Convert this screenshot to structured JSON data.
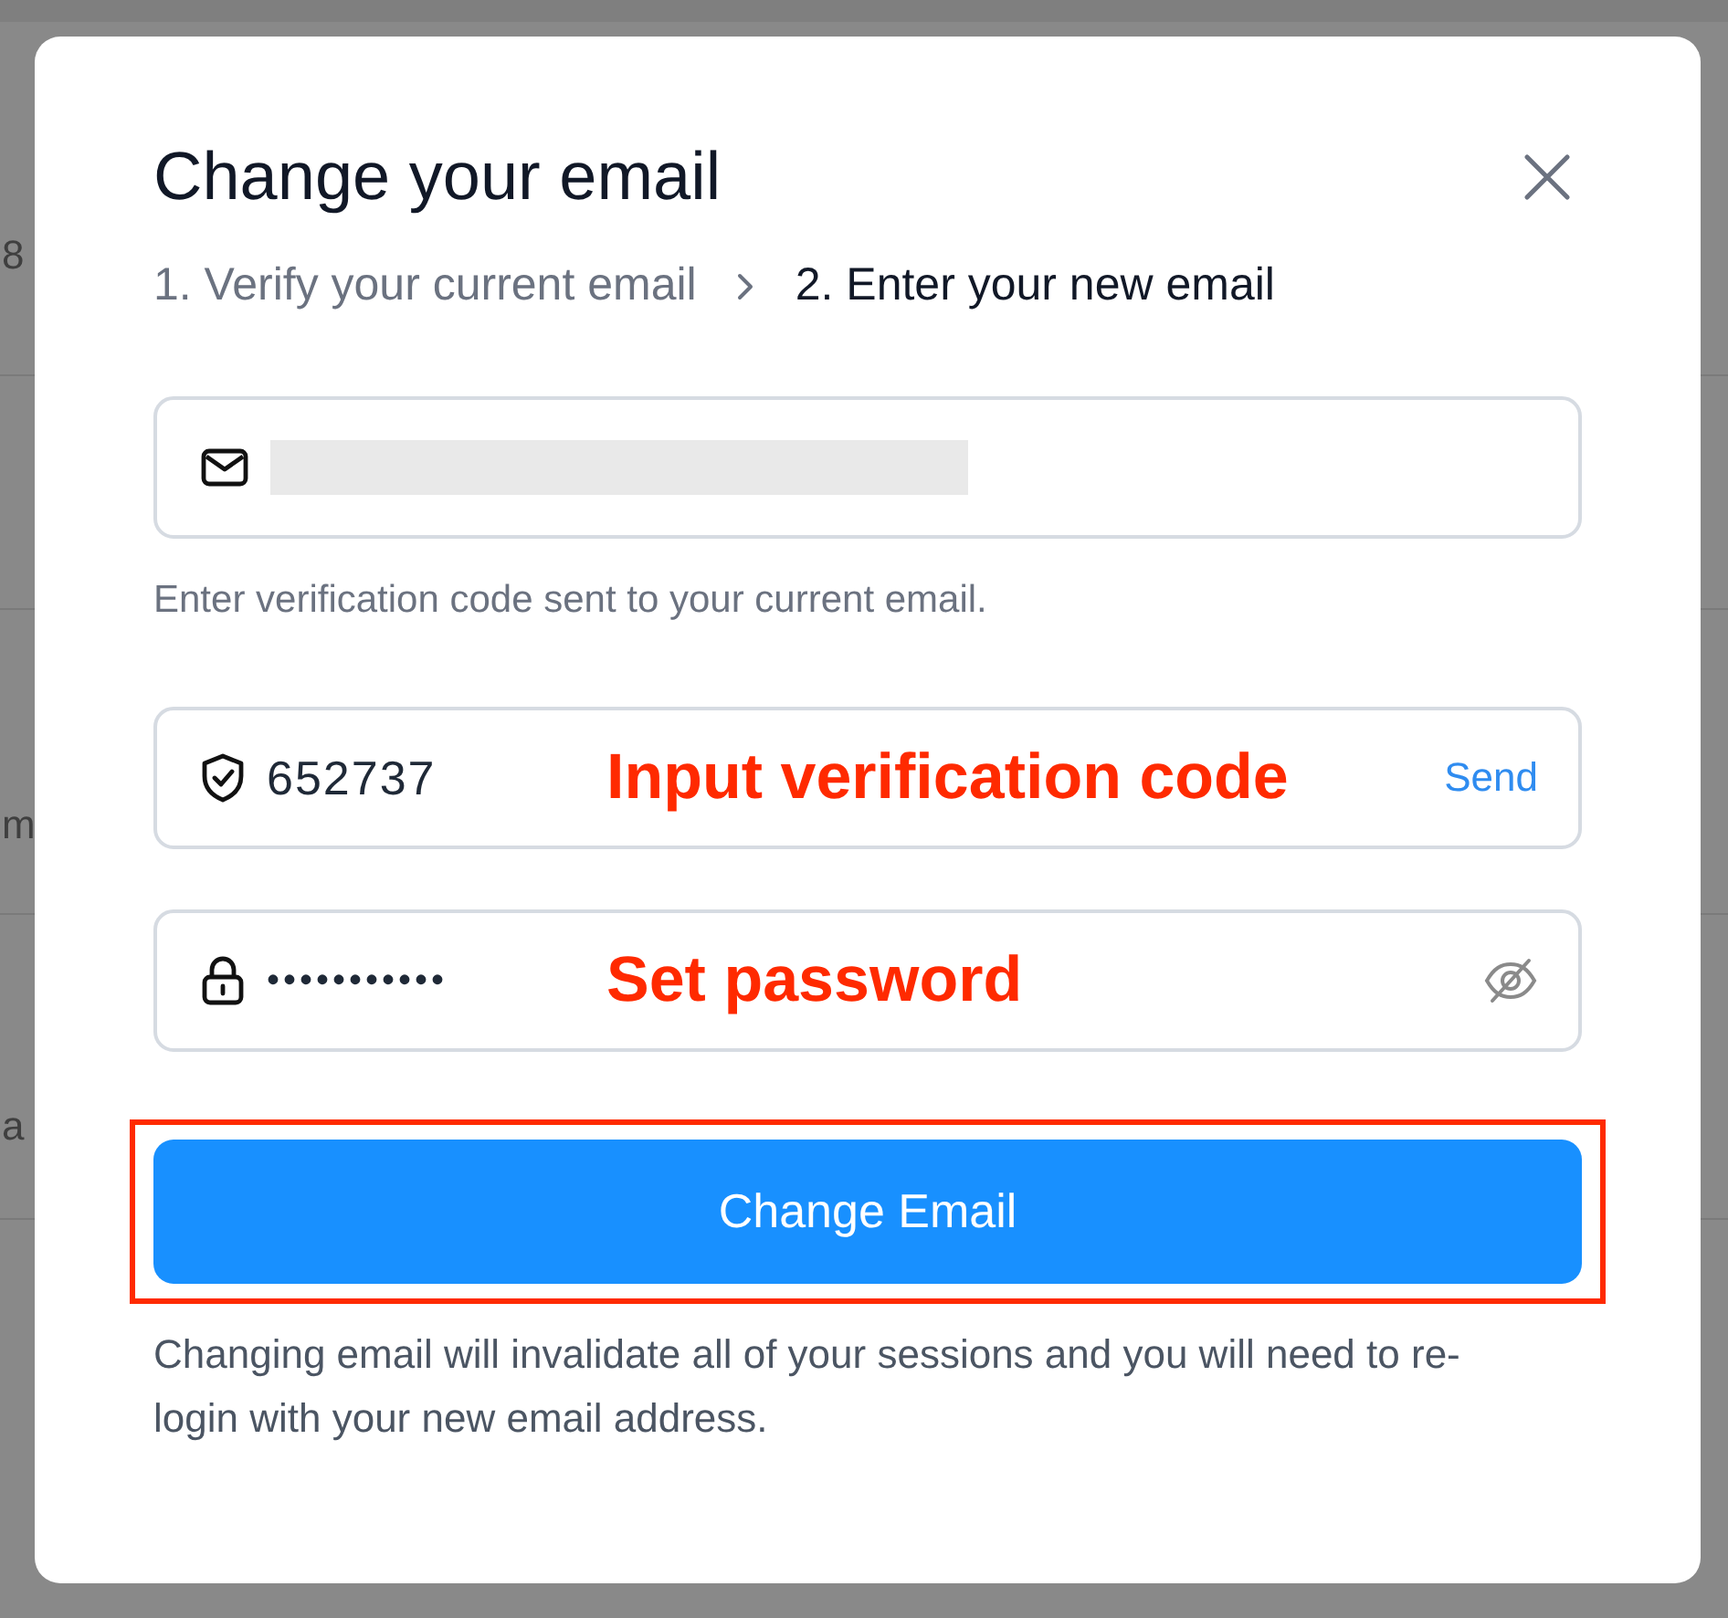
{
  "background": {
    "row_fragments": [
      "8",
      "m",
      "a"
    ]
  },
  "dialog": {
    "title": "Change your email",
    "steps": [
      {
        "label": "1. Verify your current email",
        "selected": false
      },
      {
        "label": "2. Enter your new email",
        "selected": true
      }
    ],
    "email_field": {
      "redacted": true
    },
    "hint": "Enter verification code sent to your current email.",
    "code_field": {
      "value": "652737",
      "annotation": "Input verification code",
      "action": "Send"
    },
    "password_field": {
      "value": "•••••••••••",
      "annotation": "Set password",
      "visible": false
    },
    "submit_button": {
      "label": "Change Email",
      "highlighted": true
    },
    "note": "Changing email will invalidate all of your sessions and you will need to re-login with your new email address."
  }
}
